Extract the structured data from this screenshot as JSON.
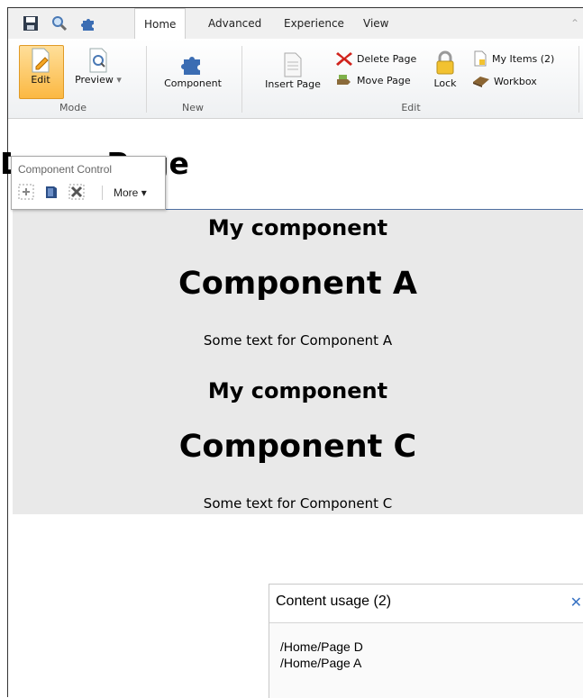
{
  "ribbon": {
    "tabs": [
      "Home",
      "Advanced",
      "Experience",
      "View"
    ],
    "mode": {
      "edit_label": "Edit",
      "preview_label": "Preview",
      "group_label": "Mode"
    },
    "new": {
      "component_label": "Component",
      "group_label": "New"
    },
    "edit": {
      "insert_page_label": "Insert Page",
      "delete_page_label": "Delete Page",
      "move_page_label": "Move Page",
      "lock_label": "Lock",
      "my_items_label": "My Items (2)",
      "workbox_label": "Workbox",
      "group_label": "Edit"
    }
  },
  "page": {
    "title": "Demo Page",
    "title_visible": "mo Page"
  },
  "component_control": {
    "title": "Component Control",
    "more_label": "More"
  },
  "components": [
    {
      "heading": "My component",
      "title": "Component A",
      "text": "Some text for Component A"
    },
    {
      "heading": "My component",
      "title": "Component C",
      "text": "Some text for Component C"
    }
  ],
  "content_usage": {
    "title": "Content usage (2)",
    "items": [
      "/Home/Page D",
      "/Home/Page A"
    ]
  },
  "colors": {
    "accent": "#3a74c4",
    "edit_active": "#fbb842",
    "component_bg": "#e9e9e9"
  }
}
